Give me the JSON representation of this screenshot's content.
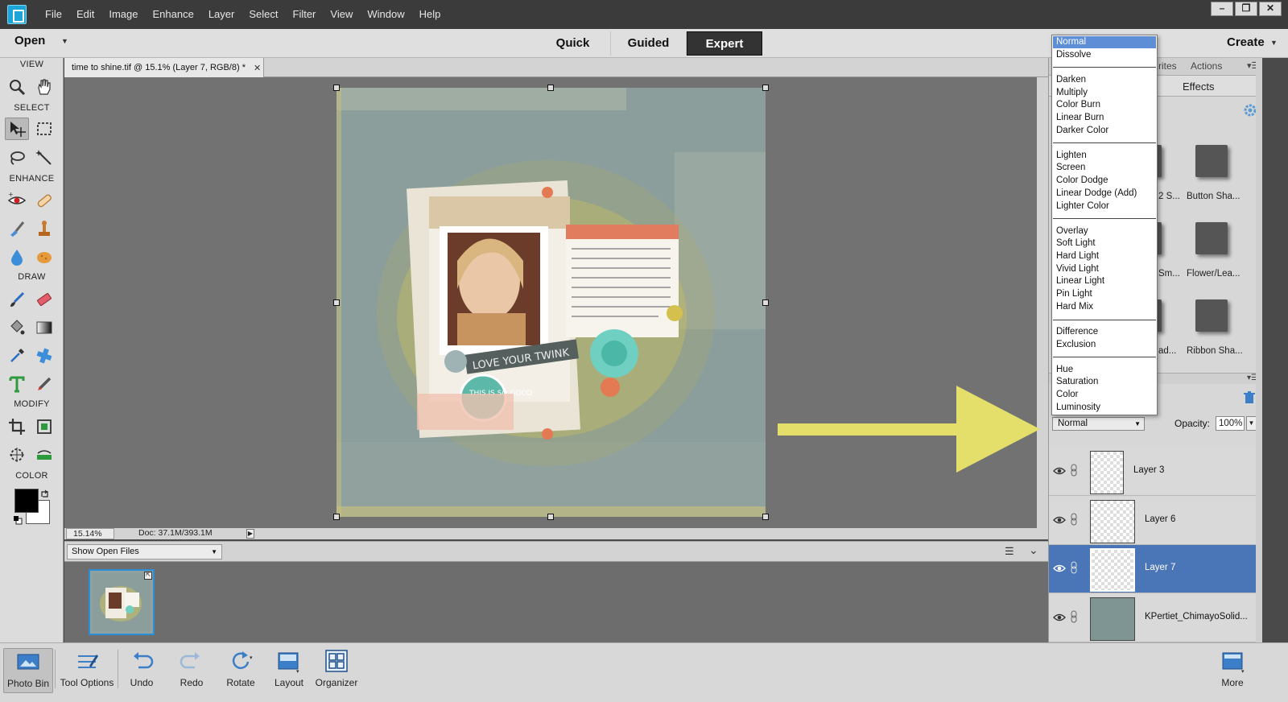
{
  "menu": [
    "File",
    "Edit",
    "Image",
    "Enhance",
    "Layer",
    "Select",
    "Filter",
    "View",
    "Window",
    "Help"
  ],
  "window_controls": [
    "–",
    "❐",
    "✕"
  ],
  "modebar": {
    "open_label": "Open",
    "tabs": [
      "Quick",
      "Guided",
      "Expert"
    ],
    "active_tab": "Expert",
    "create_label": "Create"
  },
  "toolbox": {
    "sections": [
      "VIEW",
      "SELECT",
      "ENHANCE",
      "DRAW",
      "MODIFY",
      "COLOR"
    ],
    "tools": [
      "zoom-tool",
      "hand-tool",
      "move-tool",
      "marquee-tool",
      "lasso-tool",
      "magic-wand-tool",
      "red-eye-tool",
      "spot-healing-tool",
      "smart-brush-tool",
      "clone-stamp-tool",
      "blur-tool",
      "sponge-tool",
      "brush-tool",
      "eraser-tool",
      "paint-bucket-tool",
      "gradient-tool",
      "eyedropper-tool",
      "custom-shape-tool",
      "type-tool",
      "pencil-tool",
      "crop-tool",
      "recompose-tool",
      "content-aware-move-tool",
      "straighten-tool"
    ],
    "foreground_color": "#000000",
    "background_color": "#ffffff"
  },
  "document": {
    "tab_title": "time to shine.tif @ 15.1% (Layer 7, RGB/8) *",
    "zoom": "15.14%",
    "doc_size": "Doc: 37.1M/393.1M"
  },
  "photo_bin": {
    "select_label": "Show Open Files"
  },
  "right_panel": {
    "tabs": [
      "rites",
      "Actions"
    ],
    "effects_label": "Effects",
    "styles": [
      {
        "label": "2 S..."
      },
      {
        "label": "Button Sha..."
      },
      {
        "label": "Sm..."
      },
      {
        "label": "Flower/Lea..."
      },
      {
        "label": "ad..."
      },
      {
        "label": "Ribbon Sha..."
      }
    ]
  },
  "layers": {
    "blend_mode": "Normal",
    "opacity_label": "Opacity:",
    "opacity_value": "100%",
    "items": [
      {
        "name": "Layer 3",
        "selected": false
      },
      {
        "name": "Layer 6",
        "selected": false
      },
      {
        "name": "Layer 7",
        "selected": true
      },
      {
        "name": "KPertiet_ChimayoSolid...",
        "selected": false
      }
    ]
  },
  "blend_menu": {
    "selected": "Normal",
    "groups": [
      [
        "Normal",
        "Dissolve"
      ],
      [
        "Darken",
        "Multiply",
        "Color Burn",
        "Linear Burn",
        "Darker Color"
      ],
      [
        "Lighten",
        "Screen",
        "Color Dodge",
        "Linear Dodge (Add)",
        "Lighter Color"
      ],
      [
        "Overlay",
        "Soft Light",
        "Hard Light",
        "Vivid Light",
        "Linear Light",
        "Pin Light",
        "Hard Mix"
      ],
      [
        "Difference",
        "Exclusion"
      ],
      [
        "Hue",
        "Saturation",
        "Color",
        "Luminosity"
      ]
    ]
  },
  "canvas_text": {
    "photo_caption": "LOVE YOUR TWINK",
    "badge": "THIS IS SO GOOD"
  },
  "annotation": {
    "arrow_color": "#e6e06a"
  },
  "taskbar": {
    "photo_bin": "Photo Bin",
    "tool_options": "Tool Options",
    "undo": "Undo",
    "redo": "Redo",
    "rotate": "Rotate",
    "layout": "Layout",
    "organizer": "Organizer",
    "more": "More"
  }
}
